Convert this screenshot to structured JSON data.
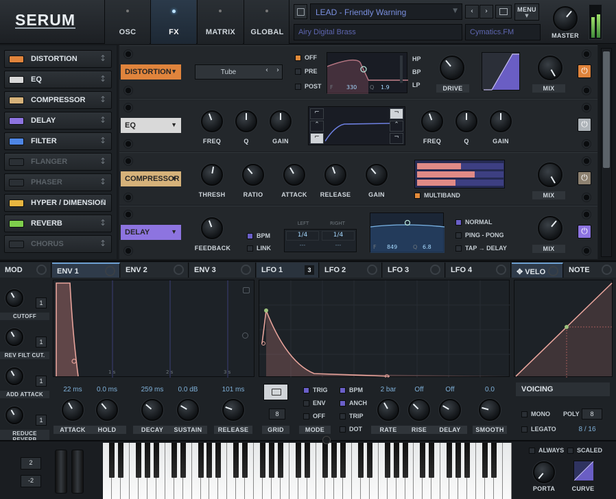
{
  "header": {
    "logo": "SERUM",
    "tabs": [
      "OSC",
      "FX",
      "MATRIX",
      "GLOBAL"
    ],
    "active_tab": "FX",
    "preset_name": "LEAD - Friendly Warning",
    "preset_desc": "Airy Digital Brass",
    "preset_author": "Cymatics.FM",
    "menu_label": "MENU",
    "master_label": "MASTER"
  },
  "fx_rack": [
    {
      "label": "DISTORTION",
      "color": "#e0843c"
    },
    {
      "label": "EQ",
      "color": "#d9d9d9"
    },
    {
      "label": "COMPRESSOR",
      "color": "#d6b27a"
    },
    {
      "label": "DELAY",
      "color": "#8d74e0"
    },
    {
      "label": "FILTER",
      "color": "#4e86e6"
    },
    {
      "label": "FLANGER",
      "color": "#2b3035"
    },
    {
      "label": "PHASER",
      "color": "#2b3035"
    },
    {
      "label": "HYPER / DIMENSION",
      "color": "#e8b640"
    },
    {
      "label": "REVERB",
      "color": "#7fcf4c"
    },
    {
      "label": "CHORUS",
      "color": "#2b3035"
    }
  ],
  "distortion": {
    "tag": "DISTORTION",
    "mode": "Tube",
    "filter_modes": [
      "OFF",
      "PRE",
      "POST"
    ],
    "filter_types": [
      "HP",
      "BP",
      "LP"
    ],
    "f_label": "F",
    "f_value": "330",
    "q_label": "Q",
    "q_value": "1.9",
    "drive_label": "DRIVE",
    "mix_label": "MIX"
  },
  "eq": {
    "tag": "EQ",
    "left_knobs": [
      "FREQ",
      "Q",
      "GAIN"
    ],
    "right_knobs": [
      "FREQ",
      "Q",
      "GAIN"
    ]
  },
  "compressor": {
    "tag": "COMPRESSOR",
    "knobs": [
      "THRESH",
      "RATIO",
      "ATTACK",
      "RELEASE",
      "GAIN"
    ],
    "multiband_label": "MULTIBAND",
    "mix_label": "MIX"
  },
  "delay": {
    "tag": "DELAY",
    "feedback_label": "FEEDBACK",
    "bpm_label": "BPM",
    "link_label": "LINK",
    "left_label": "LEFT",
    "right_label": "RIGHT",
    "left_value": "1/4",
    "right_value": "1/4",
    "left_sub": "---",
    "right_sub": "---",
    "f_label": "F",
    "f_value": "849",
    "q_label": "Q",
    "q_value": "6.8",
    "modes": [
      "NORMAL",
      "PING - PONG",
      "TAP → DELAY"
    ],
    "mix_label": "MIX"
  },
  "mod_tabs": {
    "mod": "MOD",
    "env": [
      "ENV 1",
      "ENV 2",
      "ENV 3"
    ],
    "lfo": [
      "LFO 1",
      "LFO 2",
      "LFO 3",
      "LFO 4"
    ],
    "lfo1_badge": "3",
    "velo": "VELO",
    "note": "NOTE"
  },
  "mod_targets": [
    {
      "label": "CUTOFF",
      "count": "1"
    },
    {
      "label": "REV FILT CUT.",
      "count": "1"
    },
    {
      "label": "ADD ATTACK",
      "count": "1"
    },
    {
      "label": "REDUCE REVERB",
      "count": "1"
    }
  ],
  "env_axis": [
    "1 s",
    "2 s",
    "3 s"
  ],
  "envelope": {
    "params": [
      {
        "label": "ATTACK",
        "value": "22 ms"
      },
      {
        "label": "HOLD",
        "value": "0.0 ms"
      },
      {
        "label": "DECAY",
        "value": "259 ms"
      },
      {
        "label": "SUSTAIN",
        "value": "0.0 dB"
      },
      {
        "label": "RELEASE",
        "value": "101 ms"
      }
    ]
  },
  "lfo": {
    "grid_label": "GRID",
    "grid_value": "8",
    "mode_label": "MODE",
    "trig_opts": [
      "TRIG",
      "ENV",
      "OFF"
    ],
    "bpm_opts": [
      "BPM",
      "ANCH",
      "TRIP",
      "DOT"
    ],
    "params": [
      {
        "label": "RATE",
        "value": "2 bar"
      },
      {
        "label": "RISE",
        "value": "Off"
      },
      {
        "label": "DELAY",
        "value": "Off"
      },
      {
        "label": "SMOOTH",
        "value": "0.0"
      }
    ]
  },
  "voicing": {
    "title": "VOICING",
    "mono": "MONO",
    "legato": "LEGATO",
    "poly_label": "POLY",
    "poly_value": "8",
    "voices": "8 / 16"
  },
  "keyboard": {
    "pitch_up": "2",
    "pitch_down": "-2",
    "always": "ALWAYS",
    "scaled": "SCALED",
    "porta": "PORTA",
    "curve": "CURVE"
  }
}
